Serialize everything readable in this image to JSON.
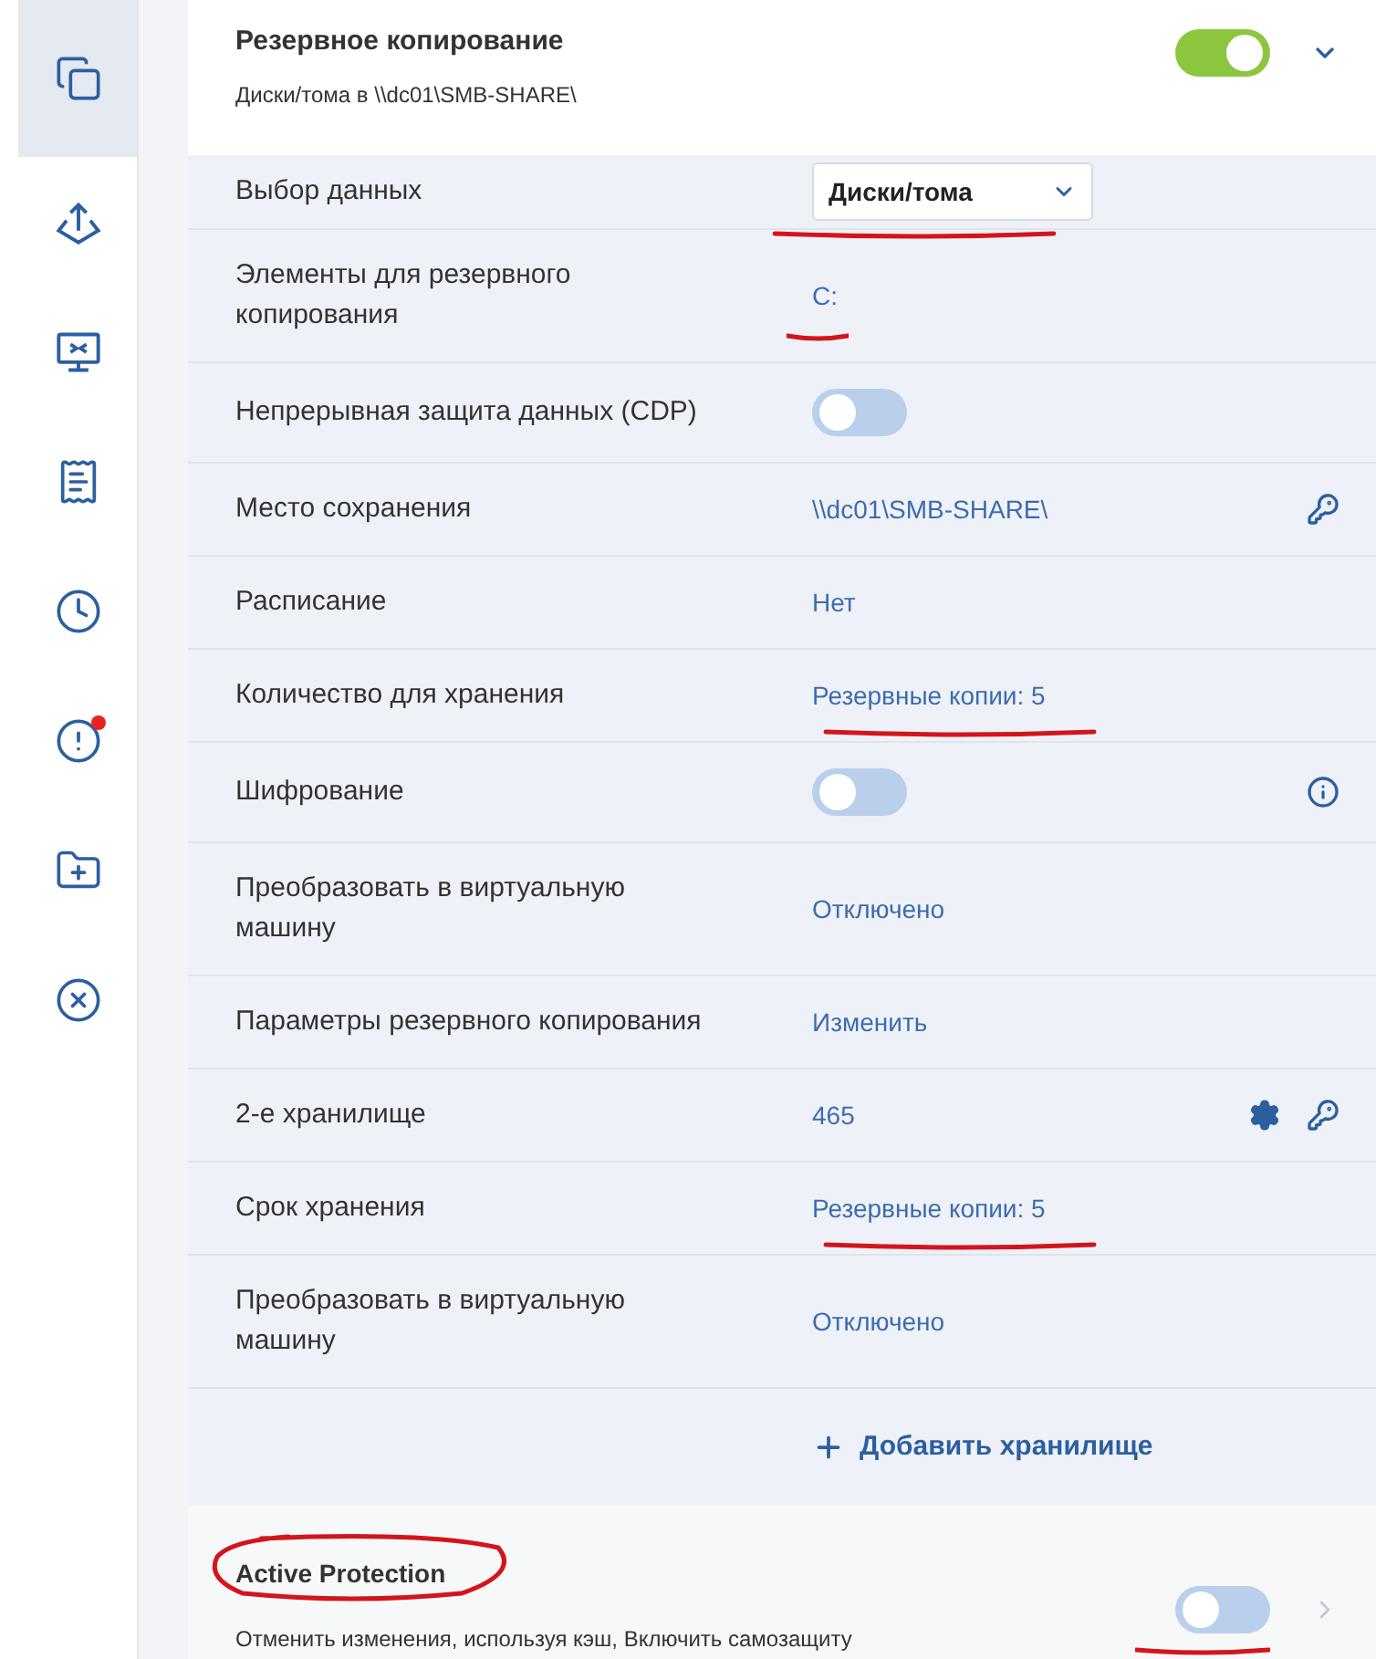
{
  "sidebar": {
    "items": [
      {
        "selected": true,
        "notification": false
      },
      {
        "selected": false,
        "notification": false
      },
      {
        "selected": false,
        "notification": false
      },
      {
        "selected": false,
        "notification": false
      },
      {
        "selected": false,
        "notification": false
      },
      {
        "selected": false,
        "notification": true
      },
      {
        "selected": false,
        "notification": false
      },
      {
        "selected": false,
        "notification": false
      }
    ]
  },
  "backup_section": {
    "title": "Резервное копирование",
    "subtitle": "Диски/тома в \\\\dc01\\SMB-SHARE\\",
    "on": true
  },
  "rows": [
    {
      "kind": "select",
      "label": "Выбор данных",
      "value": "Диски/тома"
    },
    {
      "kind": "link",
      "label": "Элементы для резервного копирования",
      "value": "C:"
    },
    {
      "kind": "toggle",
      "label": "Непрерывная защита данных (CDP)",
      "on": false
    },
    {
      "kind": "link",
      "label": "Место сохранения",
      "value": "\\\\dc01\\SMB-SHARE\\"
    },
    {
      "kind": "link",
      "label": "Расписание",
      "value": "Нет"
    },
    {
      "kind": "link",
      "label": "Количество для хранения",
      "value": "Резервные копии: 5"
    },
    {
      "kind": "toggle",
      "label": "Шифрование",
      "on": false
    },
    {
      "kind": "link",
      "label": "Преобразовать в виртуальную машину",
      "value": "Отключено"
    },
    {
      "kind": "link",
      "label": "Параметры резервного копирования",
      "value": "Изменить"
    },
    {
      "kind": "link",
      "label": "2-е хранилище",
      "value": "465"
    },
    {
      "kind": "link",
      "label": "Срок хранения",
      "value": "Резервные копии: 5"
    },
    {
      "kind": "link",
      "label": "Преобразовать в виртуальную машину",
      "value": "Отключено"
    }
  ],
  "add_storage": "Добавить хранилище",
  "active_protection": {
    "title": "Active Protection",
    "subtitle": "Отменить изменения, используя кэш, Включить самозащиту",
    "on": false
  }
}
